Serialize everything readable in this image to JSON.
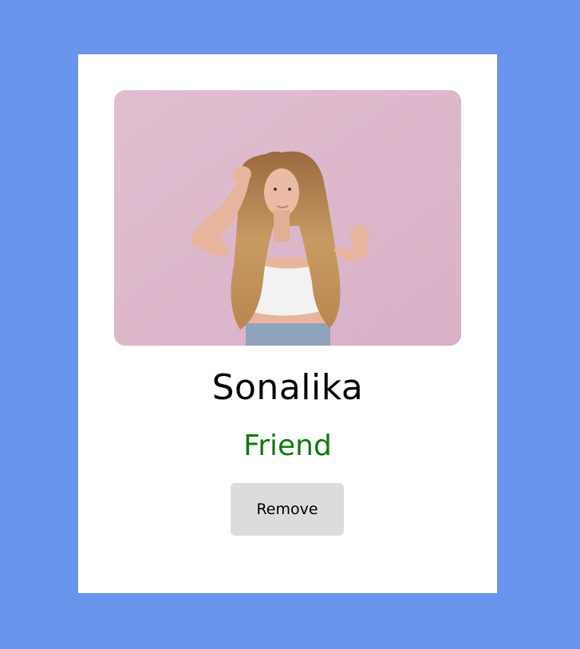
{
  "profile": {
    "name": "Sonalika",
    "status": "Friend",
    "status_color": "#0f7a0f",
    "photo_icon": "portrait-photo",
    "remove_label": "Remove"
  },
  "theme": {
    "background": "#6895ec",
    "card": "#ffffff",
    "button": "#dcdcdc"
  }
}
